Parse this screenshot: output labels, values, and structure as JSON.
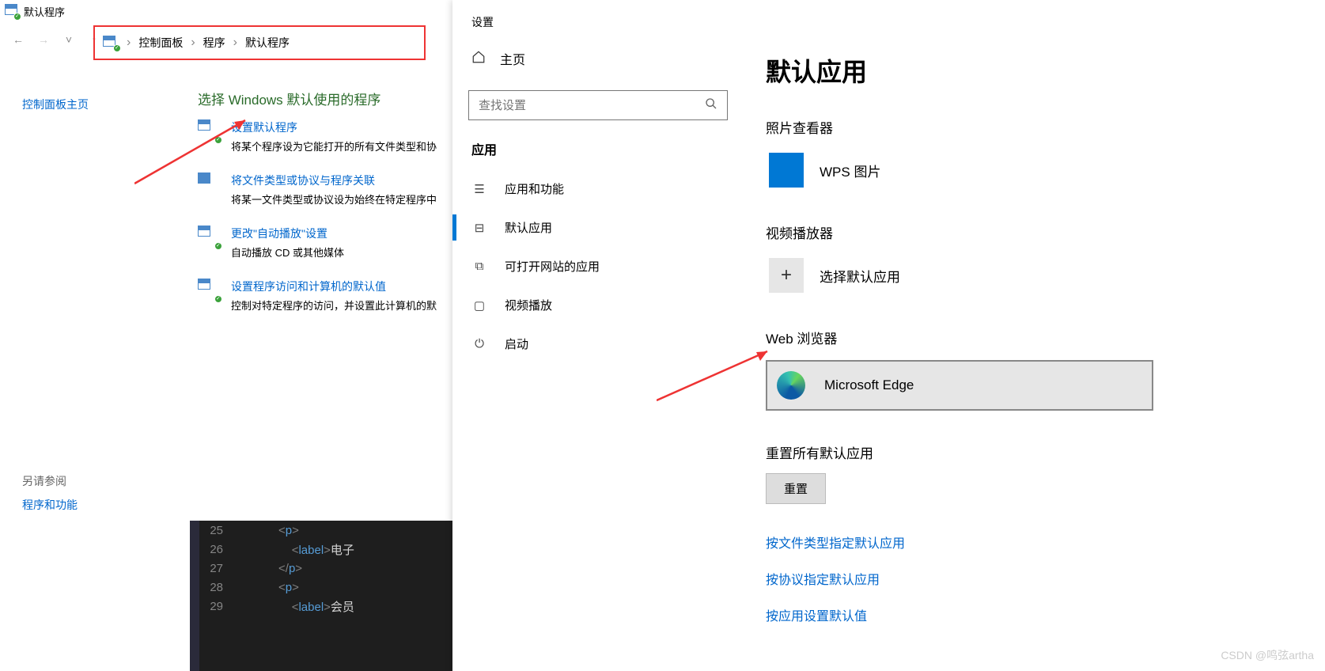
{
  "cp": {
    "title": "默认程序",
    "breadcrumb": {
      "p0": "控制面板",
      "p1": "程序",
      "p2": "默认程序"
    },
    "side_home": "控制面板主页",
    "heading": "选择 Windows 默认使用的程序",
    "items": [
      {
        "title": "设置默认程序",
        "desc": "将某个程序设为它能打开的所有文件类型和协"
      },
      {
        "title": "将文件类型或协议与程序关联",
        "desc": "将某一文件类型或协议设为始终在特定程序中"
      },
      {
        "title": "更改\"自动播放\"设置",
        "desc": "自动播放 CD 或其他媒体"
      },
      {
        "title": "设置程序访问和计算机的默认值",
        "desc": "控制对特定程序的访问，并设置此计算机的默"
      }
    ],
    "footer_h": "另请参阅",
    "footer_link": "程序和功能"
  },
  "code": {
    "l25": "25",
    "l26": "26",
    "l27": "27",
    "l28": "28",
    "l29": "29",
    "c25_open": "<p",
    "c25_close": ">",
    "c26_open": "<label>",
    "c26_txt": "电子",
    "c27": "</p>",
    "c28": "<p>",
    "c29_open": "<label>",
    "c29_txt": "会员"
  },
  "settings": {
    "title": "设置",
    "home": "主页",
    "search_ph": "查找设置",
    "nav_heading": "应用",
    "nav": [
      {
        "label": "应用和功能"
      },
      {
        "label": "默认应用"
      },
      {
        "label": "可打开网站的应用"
      },
      {
        "label": "视频播放"
      },
      {
        "label": "启动"
      }
    ],
    "main_heading": "默认应用",
    "sections": {
      "photo_h": "照片查看器",
      "photo_app": "WPS 图片",
      "video_h": "视频播放器",
      "video_app": "选择默认应用",
      "web_h": "Web 浏览器",
      "web_app": "Microsoft Edge"
    },
    "reset_h": "重置所有默认应用",
    "reset_btn": "重置",
    "links": {
      "a": "按文件类型指定默认应用",
      "b": "按协议指定默认应用",
      "c": "按应用设置默认值"
    }
  },
  "watermark": "CSDN @鸣弦artha"
}
